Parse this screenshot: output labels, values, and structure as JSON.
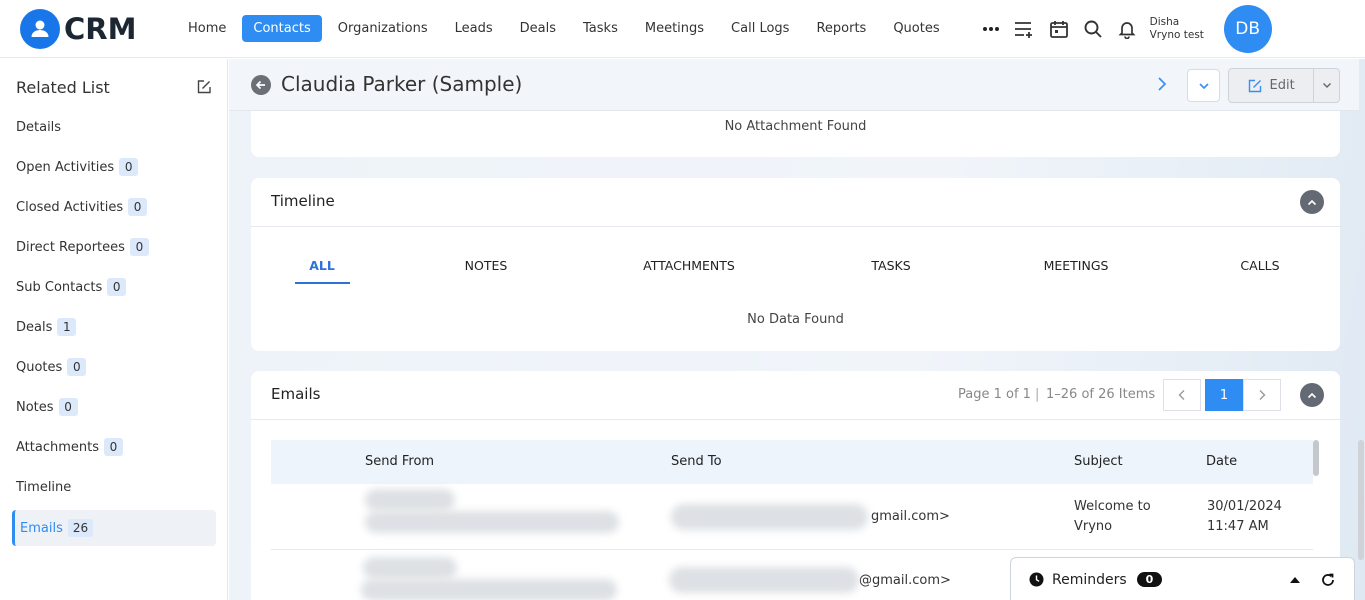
{
  "brand": {
    "name": "CRM",
    "color": "#1976e8"
  },
  "nav": {
    "items": [
      {
        "label": "Home",
        "active": false
      },
      {
        "label": "Contacts",
        "active": true
      },
      {
        "label": "Organizations",
        "active": false
      },
      {
        "label": "Leads",
        "active": false
      },
      {
        "label": "Deals",
        "active": false
      },
      {
        "label": "Tasks",
        "active": false
      },
      {
        "label": "Meetings",
        "active": false
      },
      {
        "label": "Call Logs",
        "active": false
      },
      {
        "label": "Reports",
        "active": false
      },
      {
        "label": "Quotes",
        "active": false
      }
    ],
    "icons": [
      "more-horizontal-icon",
      "add-list-icon",
      "calendar-icon",
      "search-icon",
      "bell-icon"
    ]
  },
  "user": {
    "name": "Disha",
    "org": "Vryno test",
    "initials": "DB"
  },
  "sidebar": {
    "title": "Related List",
    "items": [
      {
        "label": "Details",
        "count": null
      },
      {
        "label": "Open Activities",
        "count": "0"
      },
      {
        "label": "Closed Activities",
        "count": "0"
      },
      {
        "label": "Direct Reportees",
        "count": "0"
      },
      {
        "label": "Sub Contacts",
        "count": "0"
      },
      {
        "label": "Deals",
        "count": "1"
      },
      {
        "label": "Quotes",
        "count": "0"
      },
      {
        "label": "Notes",
        "count": "0"
      },
      {
        "label": "Attachments",
        "count": "0"
      },
      {
        "label": "Timeline",
        "count": null
      },
      {
        "label": "Emails",
        "count": "26",
        "active": true
      }
    ]
  },
  "record": {
    "title": "Claudia Parker (Sample)",
    "edit_label": "Edit"
  },
  "attachments": {
    "empty_text": "No Attachment Found"
  },
  "timeline": {
    "title": "Timeline",
    "tabs": [
      "ALL",
      "NOTES",
      "ATTACHMENTS",
      "TASKS",
      "MEETINGS",
      "CALLS"
    ],
    "active_tab": "ALL",
    "empty_text": "No Data Found"
  },
  "emails": {
    "title": "Emails",
    "page_text": "Page 1 of 1",
    "items_text": "1–26 of 26 Items",
    "current_page": "1",
    "columns": [
      "Send From",
      "Send To",
      "Subject",
      "Date"
    ],
    "rows": [
      {
        "to_suffix": "gmail.com>",
        "subject_line1": "Welcome to",
        "subject_line2": "Vryno",
        "date": "30/01/2024",
        "time": "11:47 AM"
      },
      {
        "to_suffix": "@gmail.com>"
      }
    ]
  },
  "reminders": {
    "label": "Reminders",
    "count": "0"
  }
}
